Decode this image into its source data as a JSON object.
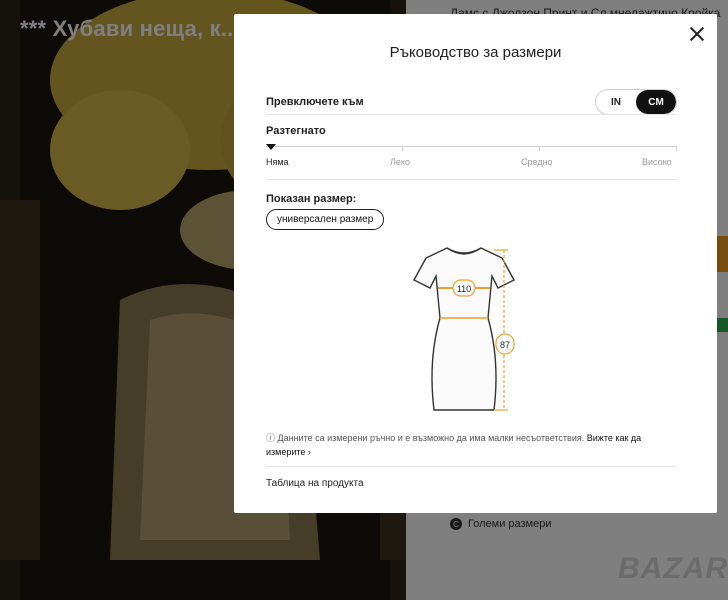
{
  "background": {
    "title": "*** Хубави неща, к....",
    "top_text": "Дамс с Джолзон Принт и Сл мнелажтичо Кройка",
    "size_link_label": "Големи размери",
    "logo": "BAZAR"
  },
  "modal": {
    "title": "Ръководство за размери",
    "switch_label": "Превключете към",
    "units": [
      "IN",
      "CM"
    ],
    "active_unit": "CM",
    "stretch_label": "Разтегнато",
    "stretch_levels": [
      "Няма",
      "Леко",
      "Средно",
      "Високо"
    ],
    "stretch_selected": "Няма",
    "shown_size_label": "Показан размер:",
    "shown_size_value": "универсален размер",
    "measurements": {
      "bust": "110",
      "length": "87"
    },
    "note": "ⓘ Данните са измерени ръчно и е възможно да има малки несъответствия.",
    "note_link": "Вижте как да измерите",
    "product_table_label": "Таблица на продукта"
  },
  "colors": {
    "accent": "#f39b1e",
    "measure_line": "#f0a030"
  }
}
